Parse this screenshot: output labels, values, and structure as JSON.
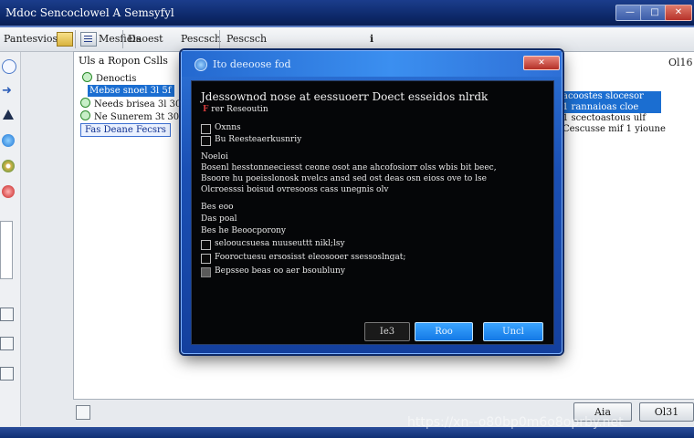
{
  "window": {
    "title": "Mdoc Sencoclowel A Semsyfyl",
    "min_glyph": "—",
    "max_glyph": "□",
    "close_glyph": "✕"
  },
  "toolbar": {
    "left_text": "Pantesvios",
    "item_1": "Mesfieis",
    "item_2": "Daoest",
    "item_3": "Pescsch",
    "info_mark": "ℹ"
  },
  "tree": {
    "header": "Uls a Ropon Cslls",
    "items": [
      {
        "label": "Denoctis",
        "state": "normal"
      },
      {
        "label": "Mebse snoel 3l 5f",
        "state": "selected"
      },
      {
        "label": "Needs brisea 3l 30",
        "state": "normal"
      },
      {
        "label": "Ne Sunerem 3t 30",
        "state": "normal"
      },
      {
        "label": "Fas Deane Fecsrs",
        "state": "outlined"
      }
    ]
  },
  "content_corner": "Ol16",
  "right_list": {
    "rows": [
      {
        "label": "acoostes slocesor",
        "state": "selected"
      },
      {
        "label": "1 rannaioas cloe",
        "state": "selected"
      },
      {
        "label": "1 scectoastous ulf",
        "state": "normal"
      },
      {
        "label": "Cescusse mif 1 yioune",
        "state": "normal"
      }
    ]
  },
  "dialog": {
    "title": "Ito deeoose fod",
    "close_glyph": "✕",
    "heading": "Jdessownod nose at eessuoerr Doect esseidos nlrdk",
    "sub": {
      "marker": "F",
      "text": "rer Reseoutin"
    },
    "options_a": [
      "Oxnns",
      "Bu Reesteaerkusnriy"
    ],
    "section_label": "Noeloi",
    "paragraph": [
      "Bosenl hesstonneeciesst ceone osot ane ahcofosiorr olss wbis bit beec,",
      "Bsoore hu poeisslonosk nvelcs ansd sed ost deas osn eioss ove to lse",
      "Olcroesssi boisud ovresooss cass unegnis olv"
    ],
    "list_labels": [
      "Bes eoo",
      "Das poal",
      "Bes he Beoocporony"
    ],
    "checkbox_items": [
      {
        "label": "selooucsuesa nuuseuttt nikl;lsy",
        "checked": false
      },
      {
        "label": "Fooroctuesu ersosisst eleosooer ssessoslngat;",
        "checked": false
      },
      {
        "label": "Bepsseo beas oo aer bsoubluny",
        "checked": true
      }
    ],
    "buttons": {
      "dark": "Ie3",
      "ok": "Roo",
      "cancel": "Uncl"
    }
  },
  "bottom": {
    "btn_1": "Aia",
    "btn_2": "Ol31"
  },
  "watermark": "https://xn--o80bp0m6o8oprby.net"
}
